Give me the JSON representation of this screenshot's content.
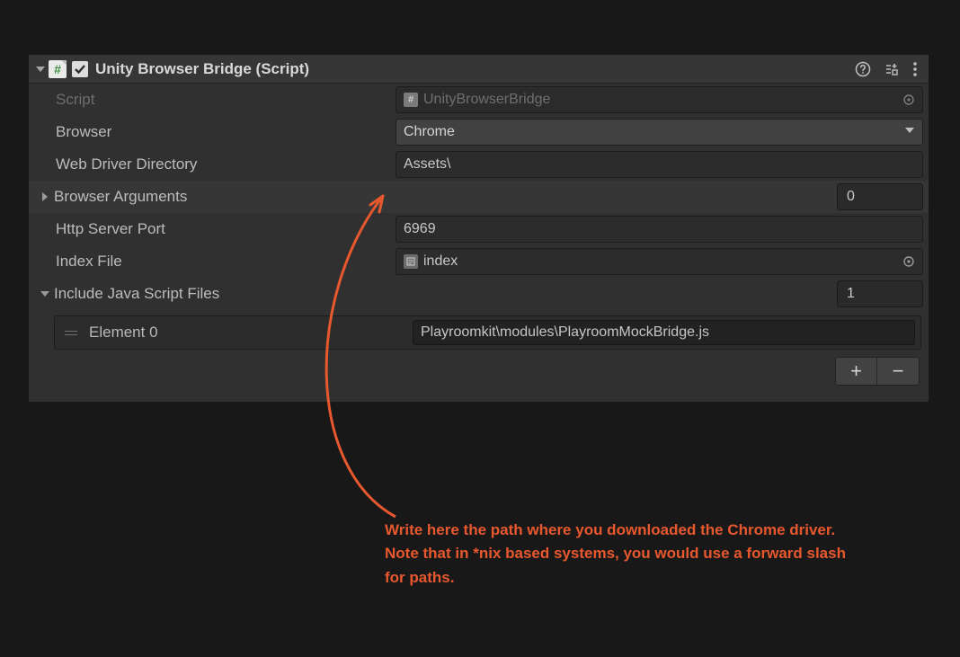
{
  "component": {
    "title": "Unity Browser Bridge (Script)",
    "enabled": true,
    "fields": {
      "script_label": "Script",
      "script_value": "UnityBrowserBridge",
      "browser_label": "Browser",
      "browser_value": "Chrome",
      "webdriver_label": "Web Driver Directory",
      "webdriver_value": "Assets\\",
      "browserargs_label": "Browser Arguments",
      "browserargs_count": "0",
      "httpport_label": "Http Server Port",
      "httpport_value": "6969",
      "indexfile_label": "Index File",
      "indexfile_value": "index",
      "jsfiles_label": "Include Java Script Files",
      "jsfiles_count": "1",
      "elements": [
        {
          "label": "Element 0",
          "value": "Playroomkit\\modules\\PlayroomMockBridge.js"
        }
      ]
    }
  },
  "annotation": {
    "line1": "Write here the path where you downloaded the Chrome driver.",
    "line2": "Note that in *nix based systems, you would use a forward slash",
    "line3": "for paths."
  }
}
